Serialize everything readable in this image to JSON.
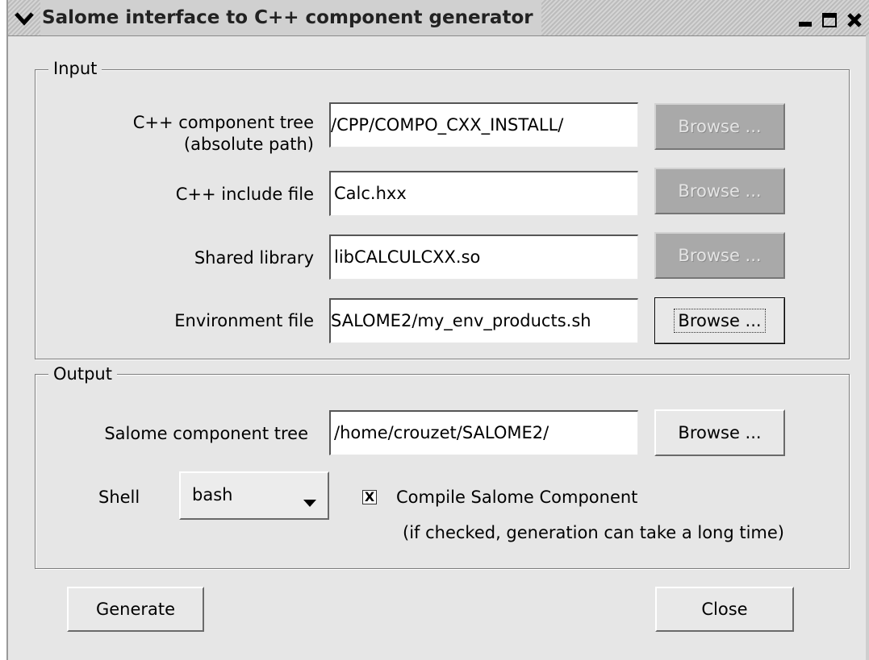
{
  "window": {
    "title": "Salome interface to C++ component generator",
    "icons": {
      "menu": "chevron-down-icon",
      "minimize": "minimize-icon",
      "maximize": "maximize-icon",
      "close": "close-icon"
    }
  },
  "input": {
    "legend": "Input",
    "rows": [
      {
        "label_line1": "C++ component tree",
        "label_line2": "(absolute path)",
        "value": "/CPP/COMPO_CXX_INSTALL/",
        "browse_label": "Browse ...",
        "browse_enabled": false
      },
      {
        "label": "C++ include file",
        "value": "Calc.hxx",
        "browse_label": "Browse ...",
        "browse_enabled": false
      },
      {
        "label": "Shared library",
        "value": "libCALCULCXX.so",
        "browse_label": "Browse ...",
        "browse_enabled": false
      },
      {
        "label": "Environment file",
        "value": "SALOME2/my_env_products.sh",
        "browse_label": "Browse ...",
        "browse_enabled": true
      }
    ]
  },
  "output": {
    "legend": "Output",
    "component_tree": {
      "label": "Salome component tree",
      "value": "/home/crouzet/SALOME2/",
      "browse_label": "Browse ..."
    },
    "shell": {
      "label": "Shell",
      "selected": "bash"
    },
    "compile": {
      "label": "Compile Salome Component",
      "note": "(if checked, generation can take a long time)",
      "checked": true,
      "mark": "X"
    }
  },
  "actions": {
    "generate_label": "Generate",
    "close_label": "Close"
  }
}
